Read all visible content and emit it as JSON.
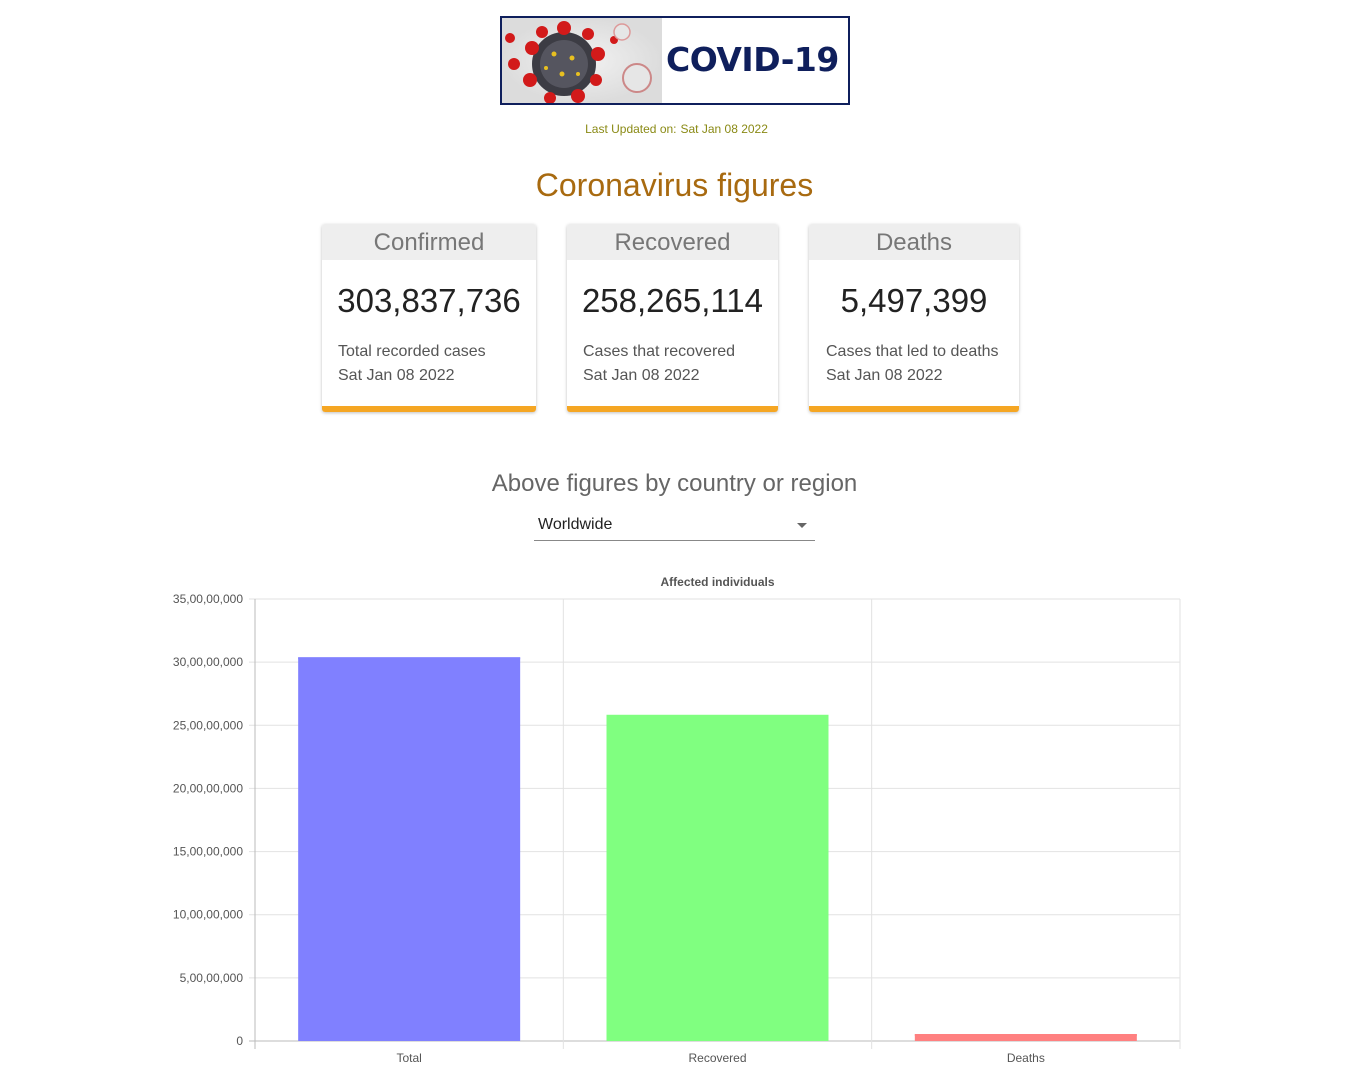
{
  "header": {
    "logo_text": "COVID-19",
    "updated_label": "Last Updated on:",
    "updated_date": "Sat Jan 08 2022"
  },
  "title": "Coronavirus figures",
  "cards": [
    {
      "title": "Confirmed",
      "value": "303,837,736",
      "description": "Total recorded cases",
      "date": "Sat Jan 08 2022"
    },
    {
      "title": "Recovered",
      "value": "258,265,114",
      "description": "Cases that recovered",
      "date": "Sat Jan 08 2022"
    },
    {
      "title": "Deaths",
      "value": "5,497,399",
      "description": "Cases that led to deaths",
      "date": "Sat Jan 08 2022"
    }
  ],
  "region": {
    "title": "Above figures by country or region",
    "selected": "Worldwide"
  },
  "colors": {
    "accent": "#f5a623",
    "title": "#a86a10",
    "total_bar": "#8080ff",
    "recovered_bar": "#80ff80",
    "deaths_bar": "#ff8080"
  },
  "chart_data": {
    "type": "bar",
    "title": "Affected individuals",
    "categories": [
      "Total",
      "Recovered",
      "Deaths"
    ],
    "values": [
      303837736,
      258265114,
      5497399
    ],
    "colors": [
      "#8080ff",
      "#80ff80",
      "#ff8080"
    ],
    "ylim": [
      0,
      350000000
    ],
    "yticks": [
      0,
      50000000,
      100000000,
      150000000,
      200000000,
      250000000,
      300000000,
      350000000
    ],
    "ytick_labels": [
      "0",
      "5,00,00,000",
      "10,00,00,000",
      "15,00,00,000",
      "20,00,00,000",
      "25,00,00,000",
      "30,00,00,000",
      "35,00,00,000"
    ],
    "grid": true,
    "legend": "none"
  }
}
